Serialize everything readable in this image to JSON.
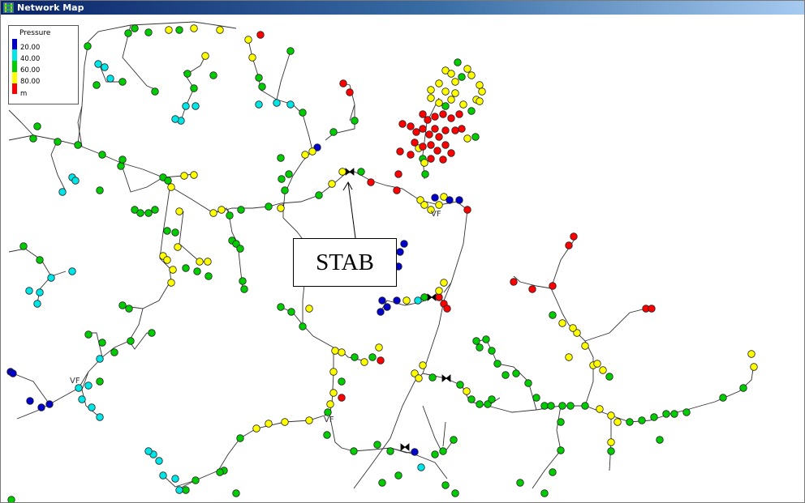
{
  "window": {
    "title": "Network Map"
  },
  "legend": {
    "title": "Pressure",
    "entries": [
      {
        "label": "20.00",
        "color": "#0000cc"
      },
      {
        "label": "40.00",
        "color": "#00e5e5"
      },
      {
        "label": "60.00",
        "color": "#00cc00"
      },
      {
        "label": "80.00",
        "color": "#ffff00"
      },
      {
        "label": "m",
        "color": "#ff0000"
      }
    ]
  },
  "callout": {
    "text": "STAB"
  },
  "markers": {
    "valve_label": "VF"
  },
  "colors": {
    "titlebar_start": "#0a246a",
    "titlebar_end": "#a6caf0",
    "pipe": "#333333",
    "node_outline": "#222222",
    "band_blue": "#0000cc",
    "band_cyan": "#00e5e5",
    "band_green": "#00cc00",
    "band_yellow": "#ffff00",
    "band_red": "#ff0000"
  }
}
